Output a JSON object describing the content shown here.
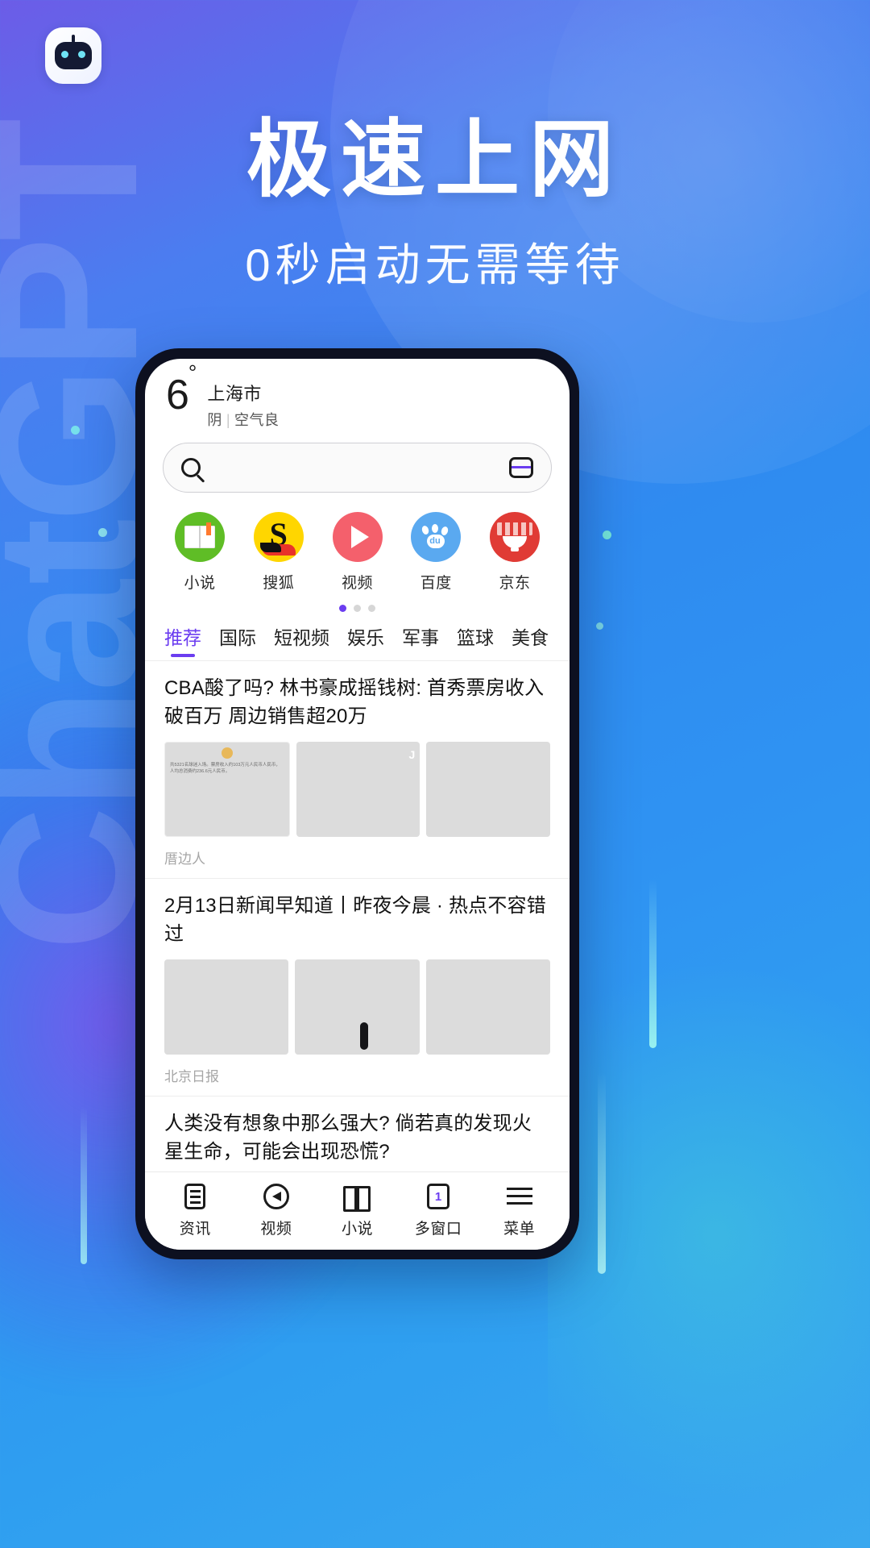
{
  "app": {
    "logo_icon": "chatgpt-robot-logo",
    "watermark_text": "ChatGPT"
  },
  "hero": {
    "title": "极速上网",
    "subtitle": "0秒启动无需等待"
  },
  "phone": {
    "weather": {
      "temperature": "6",
      "degree_symbol": "°",
      "city": "上海市",
      "condition": "阴",
      "separator": "|",
      "air_quality": "空气良"
    },
    "search": {
      "placeholder": "",
      "search_icon": "search-icon",
      "multiwindow_icon": "multi-window-icon"
    },
    "shortcuts": [
      {
        "label": "小说",
        "icon": "novel-book-icon"
      },
      {
        "label": "搜狐",
        "icon": "sohu-icon"
      },
      {
        "label": "视频",
        "icon": "video-play-icon"
      },
      {
        "label": "百度",
        "icon": "baidu-paw-icon"
      },
      {
        "label": "京东",
        "icon": "jd-icon"
      }
    ],
    "page_dots": {
      "count": 3,
      "active_index": 0
    },
    "tabs": [
      {
        "label": "推荐",
        "active": true
      },
      {
        "label": "国际",
        "active": false
      },
      {
        "label": "短视频",
        "active": false
      },
      {
        "label": "娱乐",
        "active": false
      },
      {
        "label": "军事",
        "active": false
      },
      {
        "label": "篮球",
        "active": false
      },
      {
        "label": "美食",
        "active": false
      }
    ],
    "tab_add_label": "＋",
    "articles": [
      {
        "title": "CBA酸了吗? 林书豪成摇钱树: 首秀票房收入破百万 周边销售超20万",
        "source": "厝边人",
        "images": [
          "stat-card",
          "photo-players",
          "photo-bus"
        ],
        "card_text": "共5321名球迷入场。票房收入约103万元人民币人民币，人均总消费约236.6元人民币。"
      },
      {
        "title": "2月13日新闻早知道丨昨夜今晨 · 热点不容错过",
        "source": "北京日报",
        "images": [
          "photo-handshake-flags",
          "photo-speaker",
          "photo-rescue"
        ]
      },
      {
        "title": "人类没有想象中那么强大? 倘若真的发现火星生命，可能会出现恐慌?",
        "source": "",
        "images": [
          "photo-mars-planet",
          "photo-mars-crater",
          "photo-moon-surface"
        ]
      }
    ],
    "bottom_nav": [
      {
        "label": "资讯",
        "icon": "news-doc-icon",
        "badge": ""
      },
      {
        "label": "视频",
        "icon": "video-circle-icon",
        "badge": ""
      },
      {
        "label": "小说",
        "icon": "open-book-icon",
        "badge": ""
      },
      {
        "label": "多窗口",
        "icon": "window-count-icon",
        "badge": "1"
      },
      {
        "label": "菜单",
        "icon": "hamburger-menu-icon",
        "badge": ""
      }
    ]
  },
  "colors": {
    "accent_purple": "#6b3df0",
    "bg_blue": "#2f8bf0",
    "novel_green": "#5fbd26",
    "sohu_yellow": "#ffd600",
    "video_red": "#f4606c",
    "baidu_blue": "#5aa9f0",
    "jd_red": "#e03b35"
  }
}
